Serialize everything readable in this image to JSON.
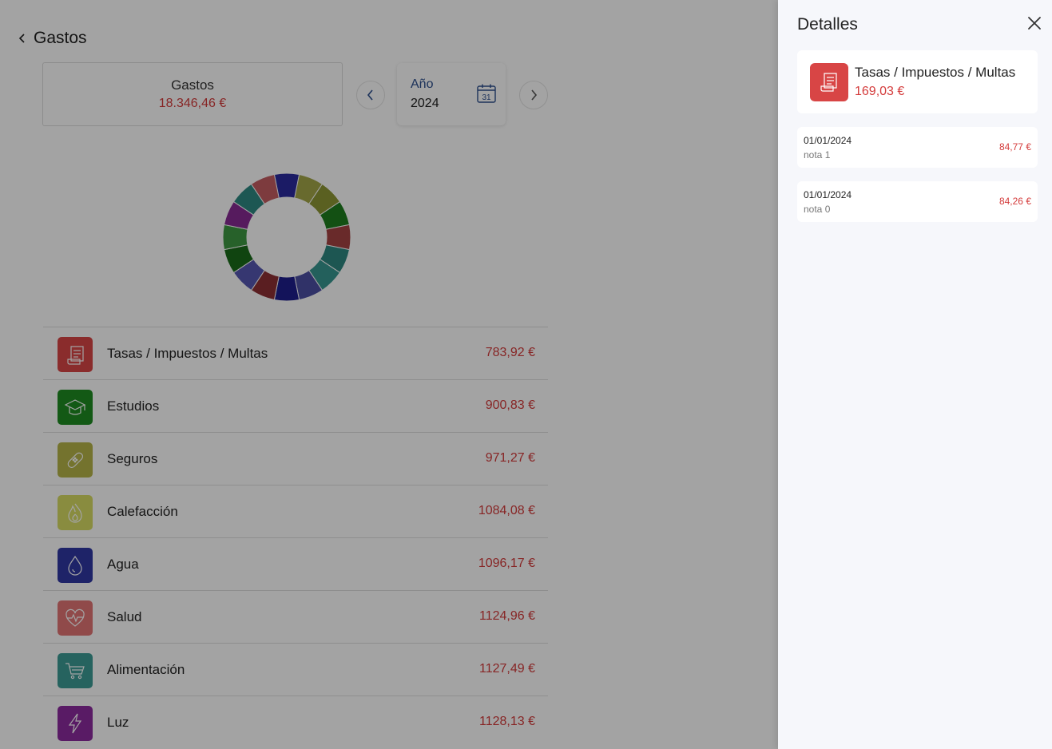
{
  "header": {
    "back_label": "Gastos"
  },
  "summary": {
    "label": "Gastos",
    "value": "18.346,46 €"
  },
  "period": {
    "label": "Año",
    "value": "2024",
    "calendar_day": "31"
  },
  "donut_colors": [
    "#2b2b9e",
    "#a3a649",
    "#8d9634",
    "#1e7d1e",
    "#a54343",
    "#2e8780",
    "#379691",
    "#4c4fa3",
    "#1f1f8e",
    "#8e3035",
    "#5556b1",
    "#1a6b1a",
    "#3e9843",
    "#872b94",
    "#2e8882",
    "#c45d62"
  ],
  "categories": [
    {
      "name": "Tasas / Impuestos / Multas",
      "amount": "783,92 €",
      "color": "#d84545",
      "icon": "receipt-icon"
    },
    {
      "name": "Estudios",
      "amount": "900,83 €",
      "color": "#1e8c22",
      "icon": "graduation-cap-icon"
    },
    {
      "name": "Seguros",
      "amount": "971,27 €",
      "color": "#b6b548",
      "icon": "bandage-icon"
    },
    {
      "name": "Calefacción",
      "amount": "1084,08 €",
      "color": "#d7dc63",
      "icon": "flame-icon"
    },
    {
      "name": "Agua",
      "amount": "1096,17 €",
      "color": "#3037a3",
      "icon": "water-drop-icon"
    },
    {
      "name": "Salud",
      "amount": "1124,96 €",
      "color": "#e27575",
      "icon": "heartbeat-icon"
    },
    {
      "name": "Alimentación",
      "amount": "1127,49 €",
      "color": "#3c9b95",
      "icon": "shopping-cart-icon"
    },
    {
      "name": "Luz",
      "amount": "1128,13 €",
      "color": "#8c2b9e",
      "icon": "lightning-icon"
    }
  ],
  "panel": {
    "title": "Detalles",
    "category": {
      "name": "Tasas / Impuestos / Multas",
      "amount": "169,03 €",
      "color": "#d84545",
      "icon": "receipt-icon"
    },
    "entries": [
      {
        "date": "01/01/2024",
        "note": "nota 1",
        "amount": "84,77 €"
      },
      {
        "date": "01/01/2024",
        "note": "nota 0",
        "amount": "84,26 €"
      }
    ]
  }
}
